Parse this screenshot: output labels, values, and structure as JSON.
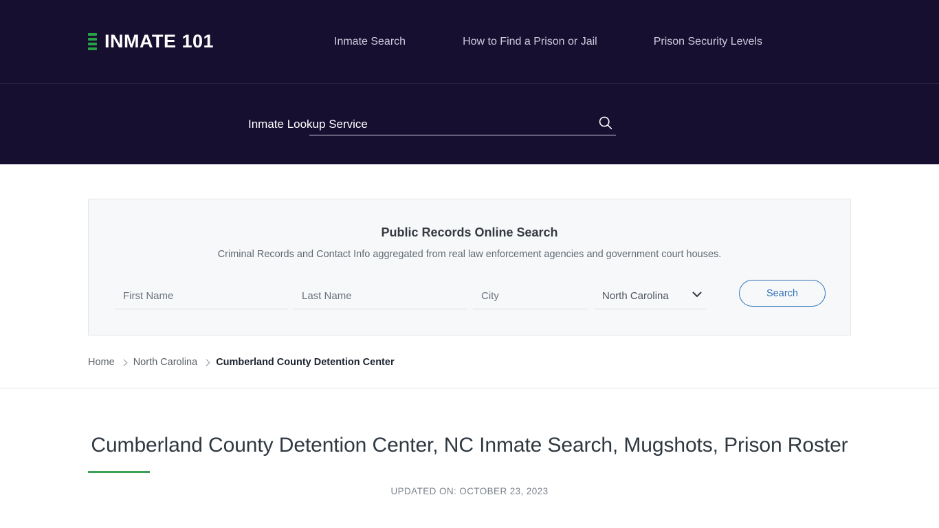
{
  "header": {
    "brand": {
      "name": "INMATE 101",
      "mark_icon": "jail-bars-icon",
      "mark_color": "#27a244"
    },
    "nav": [
      {
        "label": "Inmate Search"
      },
      {
        "label": "How to Find a Prison or Jail"
      },
      {
        "label": "Prison Security Levels"
      }
    ],
    "lookup": {
      "label": "Inmate Lookup Service",
      "input_value": "",
      "input_placeholder": "",
      "search_icon": "search-icon"
    },
    "background_color": "#170f30"
  },
  "records_panel": {
    "title": "Public Records Online Search",
    "subtitle": "Criminal Records and Contact Info aggregated from real law enforcement agencies and government court houses.",
    "fields": {
      "first_name": {
        "placeholder": "First Name",
        "value": ""
      },
      "last_name": {
        "placeholder": "Last Name",
        "value": ""
      },
      "city": {
        "placeholder": "City",
        "value": ""
      },
      "state": {
        "selected": "North Carolina",
        "chevron_icon": "chevron-down-icon"
      }
    },
    "search_button": "Search",
    "accent_color": "#2f72b8",
    "background_color": "#f7f8fa"
  },
  "breadcrumb": {
    "home": "Home",
    "state": "North Carolina",
    "current": "Cumberland County Detention Center"
  },
  "article": {
    "title": "Cumberland County Detention Center, NC Inmate Search, Mugshots, Prison Roster",
    "updated_on": "UPDATED ON: OCTOBER 23, 2023",
    "rule_color": "#3ba154"
  }
}
